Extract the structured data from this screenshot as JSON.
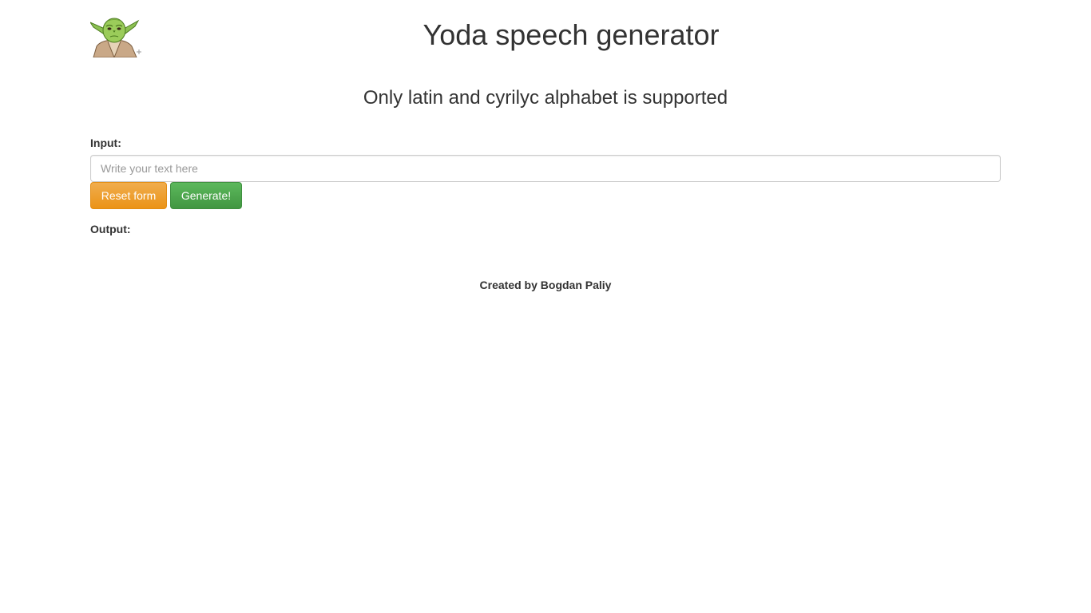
{
  "header": {
    "logo_icon": "yoda-icon",
    "title": "Yoda speech generator"
  },
  "notice": "Only latin and cyrilyc alphabet is supported",
  "form": {
    "input_label": "Input:",
    "input_placeholder": "Write your text here",
    "input_value": "",
    "reset_label": "Reset form",
    "generate_label": "Generate!",
    "output_label": "Output:",
    "output_value": ""
  },
  "footer": {
    "credit": "Created by Bogdan Paliy"
  },
  "colors": {
    "reset_button": "#f0ad4e",
    "generate_button": "#5cb85c",
    "text": "#333333"
  }
}
